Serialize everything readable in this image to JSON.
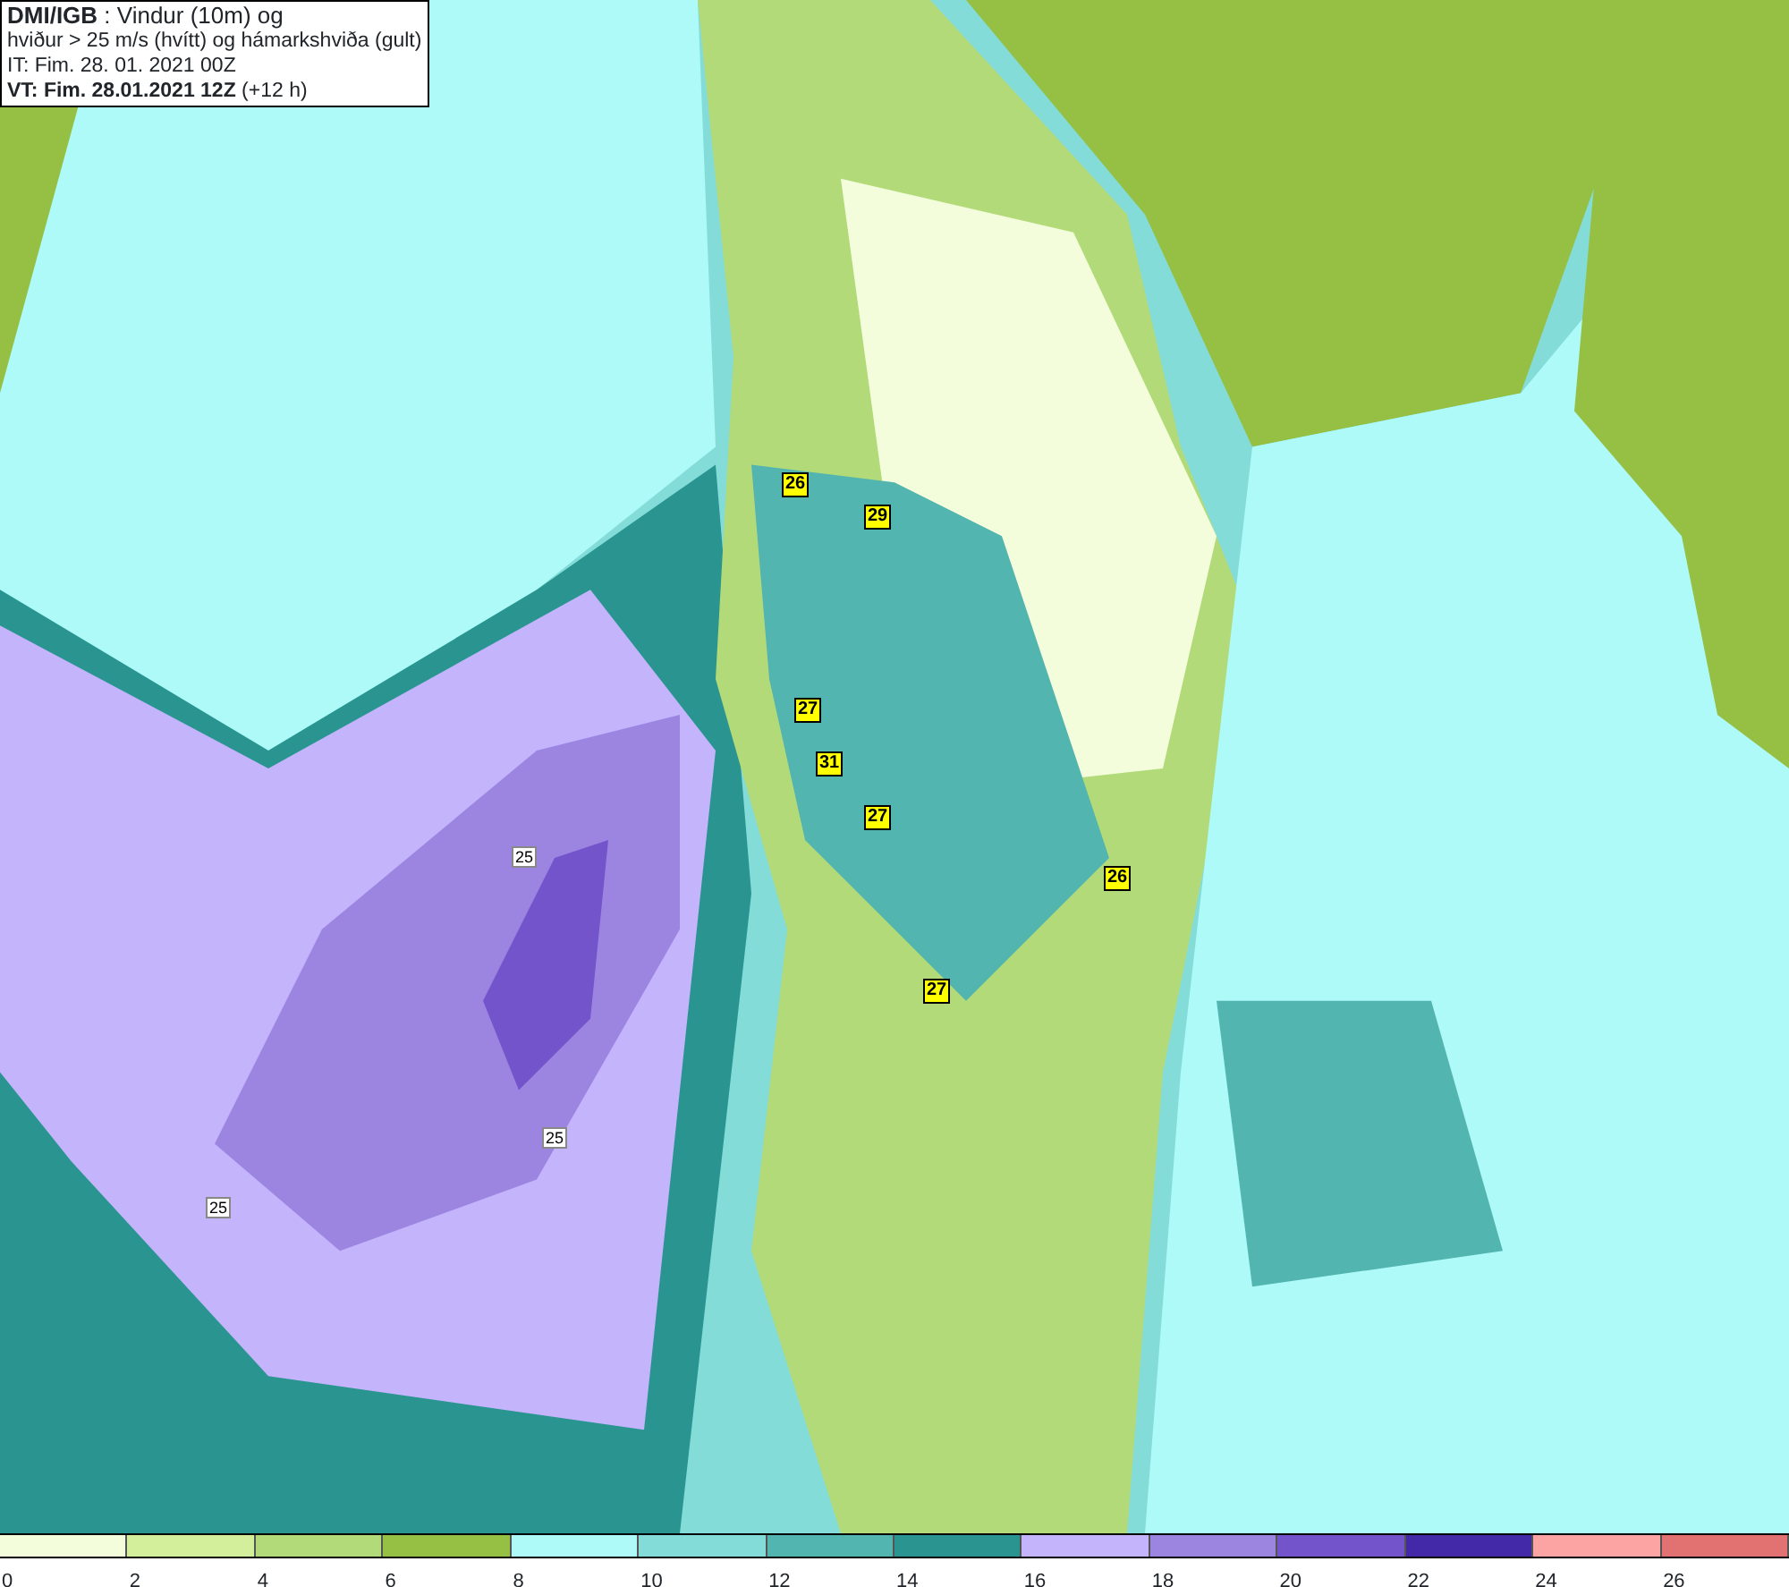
{
  "header": {
    "lines": [
      "**DMI/IGB** : Vindur (10m) og",
      "hviður > 25 m/s (hvítt) og hámarkshviða (gult)",
      "IT: Fim. 28. 01. 2021 00Z",
      "**VT: Fim. 28.01.2021 12Z** (+12 h)"
    ]
  },
  "map": {
    "gust_labels": [
      "26",
      "29",
      "27",
      "31",
      "27",
      "26",
      "27"
    ],
    "contour_labels": [
      "25",
      "25",
      "25"
    ]
  },
  "legend": {
    "bins": [
      {
        "color": "#f3fddb"
      },
      {
        "color": "#d3ef9c"
      },
      {
        "color": "#b3da78"
      },
      {
        "color": "#96c043"
      },
      {
        "color": "#adfaf8"
      },
      {
        "color": "#83dcd8"
      },
      {
        "color": "#52b5b0"
      },
      {
        "color": "#2a9590"
      },
      {
        "color": "#c4b4fb"
      },
      {
        "color": "#9b85e0"
      },
      {
        "color": "#7454cb"
      },
      {
        "color": "#4328a8"
      },
      {
        "color": "#fca3a3"
      },
      {
        "color": "#e27272"
      }
    ],
    "ticks": [
      "0",
      "2",
      "4",
      "6",
      "8",
      "10",
      "12",
      "14",
      "16",
      "18",
      "20",
      "22",
      "24",
      "26"
    ]
  }
}
